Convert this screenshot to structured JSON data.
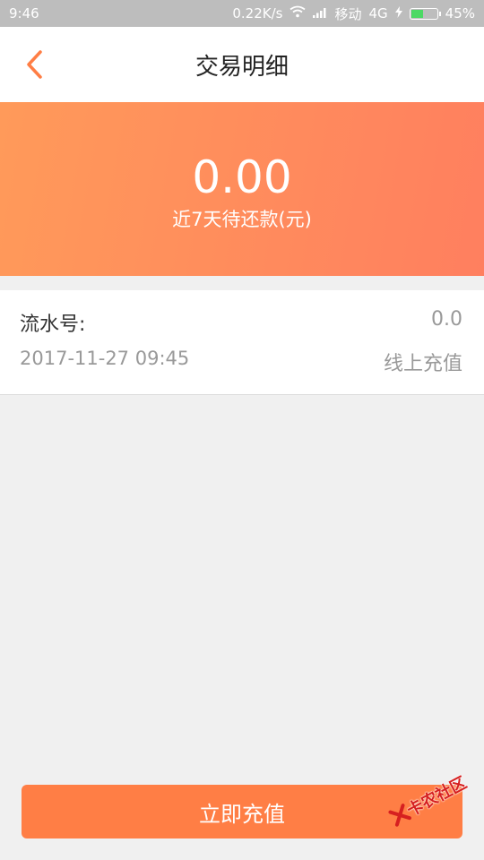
{
  "status_bar": {
    "time": "9:46",
    "net_speed": "0.22K/s",
    "carrier": "移动",
    "network": "4G",
    "battery_text": "45%",
    "battery_level": 0.45
  },
  "header": {
    "title": "交易明细"
  },
  "summary": {
    "amount": "0.00",
    "label": "近7天待还款(元)"
  },
  "records": [
    {
      "serial_label": "流水号:",
      "amount": "0.0",
      "time": "2017-11-27 09:45",
      "type": "线上充值"
    }
  ],
  "action": {
    "recharge_label": "立即充值"
  },
  "watermark": {
    "text": "卡农社区"
  },
  "colors": {
    "accent": "#ff7e45",
    "gradient_start": "#ff9a5a",
    "gradient_end": "#ff7f5f"
  }
}
